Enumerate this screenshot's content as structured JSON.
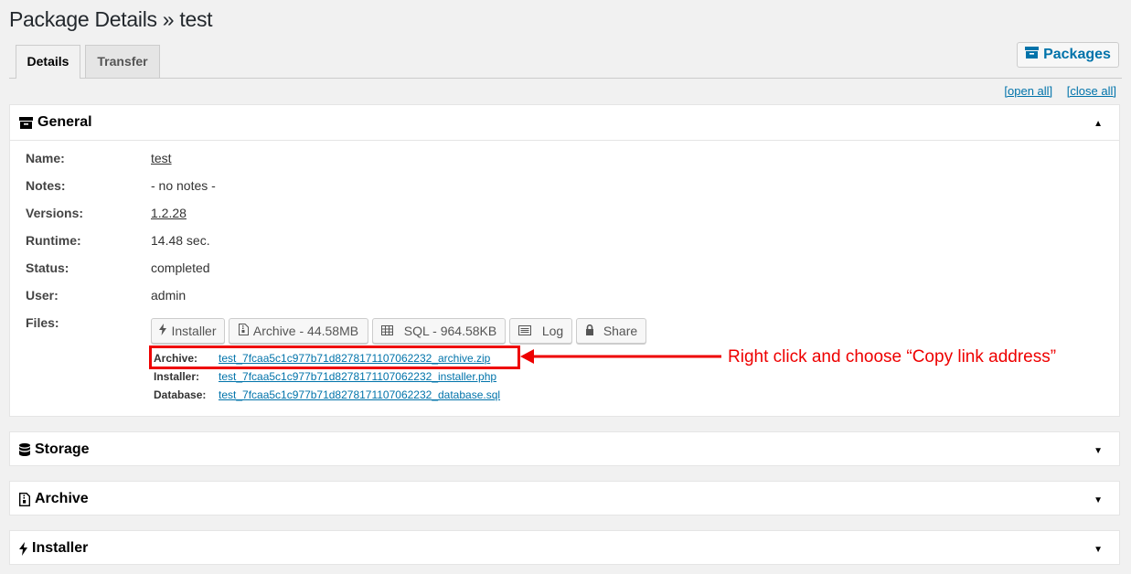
{
  "page": {
    "title": "Package Details » test"
  },
  "tabs": [
    {
      "label": "Details"
    },
    {
      "label": "Transfer"
    }
  ],
  "packages_button": {
    "label": "Packages",
    "icon": "archive-box-icon"
  },
  "toggles": {
    "open_all": "[open all]",
    "close_all": "[close all]"
  },
  "general": {
    "title": "General",
    "fields": [
      {
        "label": "Name:",
        "value": "test"
      },
      {
        "label": "Notes:",
        "value": "- no notes -"
      },
      {
        "label": "Versions:",
        "value": "1.2.28"
      },
      {
        "label": "Runtime:",
        "value": "14.48 sec."
      },
      {
        "label": "Status:",
        "value": "completed"
      },
      {
        "label": "User:",
        "value": "admin"
      },
      {
        "label": "Files:"
      }
    ],
    "file_buttons": [
      {
        "label": "Installer",
        "icon": "bolt-icon"
      },
      {
        "label": "Archive - 44.58MB",
        "icon": "file-archive-icon"
      },
      {
        "label": "SQL - 964.58KB",
        "icon": "table-icon"
      },
      {
        "label": "Log",
        "icon": "log-icon"
      },
      {
        "label": "Share",
        "icon": "lock-icon"
      }
    ],
    "file_links": [
      {
        "label": "Archive:",
        "value": "test_7fcaa5c1c977b71d8278171107062232_archive.zip"
      },
      {
        "label": "Installer:",
        "value": "test_7fcaa5c1c977b71d8278171107062232_installer.php"
      },
      {
        "label": "Database:",
        "value": "test_7fcaa5c1c977b71d8278171107062232_database.sql"
      }
    ]
  },
  "annotation": {
    "text": "Right click and choose “Copy link address”",
    "color": "#ee0000"
  },
  "sections": [
    {
      "title": "Storage",
      "icon": "database-icon"
    },
    {
      "title": "Archive",
      "icon": "file-archive-icon"
    },
    {
      "title": "Installer",
      "icon": "bolt-icon"
    }
  ],
  "colors": {
    "link": "#0073aa",
    "background": "#f1f1f1",
    "panel": "#ffffff"
  }
}
